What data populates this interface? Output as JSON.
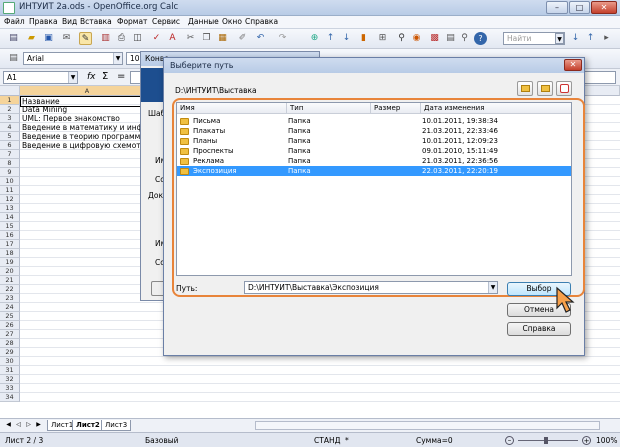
{
  "window": {
    "title": "ИНТУИТ 2a.ods - OpenOffice.org Calc",
    "btn_min": "–",
    "btn_max": "□",
    "btn_close": "✕"
  },
  "menu": [
    "Файл",
    "Правка",
    "Вид",
    "Вставка",
    "Формат",
    "Сервис",
    "Данные",
    "Окно",
    "Справка"
  ],
  "toolbar": {
    "search_placeholder": "Найти",
    "font_name": "Arial",
    "font_size": "10"
  },
  "formula_bar": {
    "cell_ref": "A1",
    "fx": "fx",
    "sigma": "Σ",
    "equals": "="
  },
  "sheet": {
    "column_a": "A",
    "rows": [
      "1",
      "2",
      "3",
      "4",
      "5",
      "6",
      "7",
      "8",
      "9",
      "10",
      "11",
      "12",
      "13",
      "14",
      "15",
      "16",
      "17",
      "18",
      "19",
      "20",
      "21",
      "22",
      "23",
      "24",
      "25",
      "26",
      "27",
      "28",
      "29",
      "30",
      "31",
      "32",
      "33",
      "34"
    ],
    "cells": [
      "Название",
      "Data Mining",
      "UML: Первое знакомство",
      "Введение в математику и инфор",
      "Введение в теорию программир",
      "Введение в цифровую схемотех"
    ]
  },
  "sheet_tabs": [
    "Лист1",
    "Лист2",
    "Лист3"
  ],
  "status": {
    "sheet": "Лист 2 / 3",
    "style": "Базовый",
    "mode": "СТАНД",
    "star": "*",
    "sum": "Сумма=0",
    "zoom": "100%"
  },
  "bg_dialog": {
    "title": "Конве",
    "labels": [
      "Шаб",
      "Им",
      "Со",
      "Док",
      "Им",
      "Со"
    ]
  },
  "dialog": {
    "title": "Выберите путь",
    "close": "✕",
    "current_path": "D:\\ИНТУИТ\\Выставка",
    "columns": [
      "Имя",
      "Тип",
      "Размер",
      "Дата изменения"
    ],
    "files": [
      {
        "name": "Письма",
        "type": "Папка",
        "size": "",
        "date": "10.01.2011, 19:38:34"
      },
      {
        "name": "Плакаты",
        "type": "Папка",
        "size": "",
        "date": "21.03.2011, 22:33:46"
      },
      {
        "name": "Планы",
        "type": "Папка",
        "size": "",
        "date": "10.01.2011, 12:09:23"
      },
      {
        "name": "Проспекты",
        "type": "Папка",
        "size": "",
        "date": "09.01.2010, 15:11:49"
      },
      {
        "name": "Реклама",
        "type": "Папка",
        "size": "",
        "date": "21.03.2011, 22:36:56"
      },
      {
        "name": "Экспозиция",
        "type": "Папка",
        "size": "",
        "date": "22.03.2011, 22:20:19"
      }
    ],
    "selected_index": 5,
    "path_label": "Путь:",
    "path_value": "D:\\ИНТУИТ\\Выставка\\Экспозиция",
    "btn_select": "Выбор",
    "btn_cancel": "Отмена",
    "btn_help": "Справка"
  }
}
